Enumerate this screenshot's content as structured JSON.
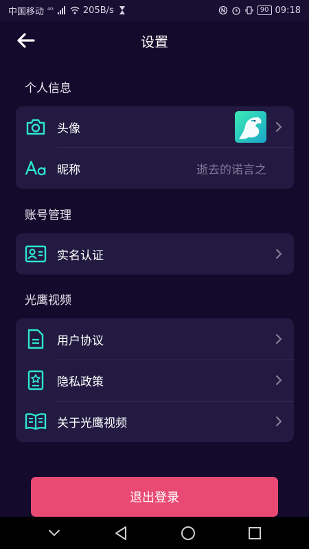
{
  "status_bar": {
    "carrier": "中国移动",
    "network": "⁴ᴳ",
    "speed": "205B/s",
    "battery": "90",
    "time": "09:18"
  },
  "header": {
    "title": "设置"
  },
  "sections": {
    "personal": {
      "title": "个人信息",
      "avatar_label": "头像",
      "nickname_label": "昵称",
      "nickname_value": "逝去的诺言之"
    },
    "account": {
      "title": "账号管理",
      "realname_label": "实名认证"
    },
    "app": {
      "title": "光鹰视频",
      "agreement_label": "用户协议",
      "privacy_label": "隐私政策",
      "about_label": "关于光鹰视频"
    }
  },
  "logout_label": "退出登录",
  "colors": {
    "background": "#140b2c",
    "card": "#221a41",
    "accent_icon": "#2ee6d0",
    "logout": "#e94a74"
  },
  "icons": {
    "back": "arrow-left-icon",
    "avatar": "camera-icon",
    "nickname": "font-aa-icon",
    "realname": "id-card-icon",
    "agreement": "document-icon",
    "privacy": "badge-star-icon",
    "about": "open-book-icon"
  }
}
